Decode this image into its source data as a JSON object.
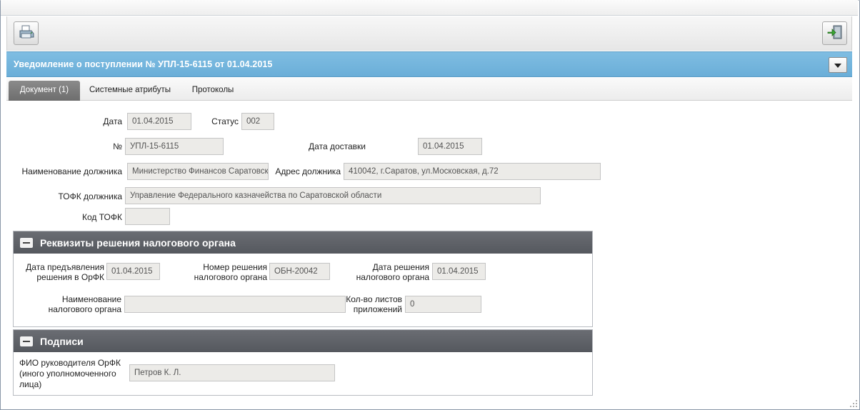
{
  "window": {
    "title": "Уведомление о поступлении № УПЛ-15-6115 от 01.04.2015"
  },
  "toolbar": {
    "print_icon": "printer-icon",
    "exit_icon": "exit-door-icon"
  },
  "tabs": [
    {
      "label": "Документ (1)",
      "active": true
    },
    {
      "label": "Системные атрибуты",
      "active": false
    },
    {
      "label": "Протоколы",
      "active": false
    }
  ],
  "form": {
    "date_label": "Дата",
    "date_value": "01.04.2015",
    "status_label": "Статус",
    "status_value": "002",
    "number_label": "№",
    "number_value": "УПЛ-15-6115",
    "delivery_date_label": "Дата доставки",
    "delivery_date_value": "01.04.2015",
    "debtor_name_label": "Наименование должника",
    "debtor_name_value": "Министерство Финансов Саратовской области",
    "debtor_address_label": "Адрес должника",
    "debtor_address_value": "410042, г.Саратов, ул.Московская, д.72",
    "tofk_label": "ТОФК должника",
    "tofk_value": "Управление Федерального казначейства по Саратовской области",
    "tofk_code_label": "Код ТОФК",
    "tofk_code_value": ""
  },
  "tax_section": {
    "title": "Реквизиты решения налогового органа",
    "presented_date_label_1": "Дата предъявления",
    "presented_date_label_2": "решения в ОрФК",
    "presented_date_value": "01.04.2015",
    "decision_number_label_1": "Номер решения",
    "decision_number_label_2": "налогового органа",
    "decision_number_value": "ОБН-20042",
    "decision_date_label_1": "Дата решения",
    "decision_date_label_2": "налогового органа",
    "decision_date_value": "01.04.2015",
    "tax_authority_label_1": "Наименование",
    "tax_authority_label_2": "налогового органа",
    "tax_authority_value": "",
    "sheets_label_1": "Кол-во листов",
    "sheets_label_2": "приложений",
    "sheets_value": "0"
  },
  "signatures_section": {
    "title": "Подписи",
    "head_label_1": "ФИО руководителя ОрФК",
    "head_label_2": "(иного уполномоченного",
    "head_label_3": "лица)",
    "head_value": "Петров К. Л."
  }
}
